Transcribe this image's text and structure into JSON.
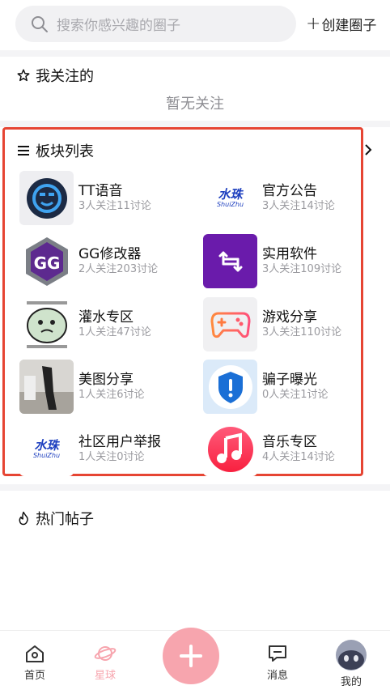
{
  "search": {
    "placeholder": "搜索你感兴趣的圈子"
  },
  "create_label": "创建圈子",
  "following": {
    "title": "我关注的",
    "empty_text": "暂无关注"
  },
  "boards_section": {
    "title": "板块列表"
  },
  "boards": [
    {
      "name": "TT语音",
      "meta": "3人关注11讨论",
      "icon": "tt-voice-icon"
    },
    {
      "name": "官方公告",
      "meta": "3人关注14讨论",
      "icon": "shuizhu-logo",
      "logo_text": "水珠",
      "logo_sub": "ShuiZhu"
    },
    {
      "name": "GG修改器",
      "meta": "2人关注203讨论",
      "icon": "gg-modifier-icon"
    },
    {
      "name": "实用软件",
      "meta": "3人关注109讨论",
      "icon": "swap-arrows-icon"
    },
    {
      "name": "灌水专区",
      "meta": "1人关注47讨论",
      "icon": "meme-image"
    },
    {
      "name": "游戏分享",
      "meta": "3人关注110讨论",
      "icon": "gamepad-icon"
    },
    {
      "name": "美图分享",
      "meta": "1人关注6讨论",
      "icon": "photo-thumbnail"
    },
    {
      "name": "骗子曝光",
      "meta": "0人关注1讨论",
      "icon": "shield-alert-icon"
    },
    {
      "name": "社区用户举报",
      "meta": "1人关注0讨论",
      "icon": "shuizhu-logo",
      "logo_text": "水珠",
      "logo_sub": "ShuiZhu"
    },
    {
      "name": "音乐专区",
      "meta": "4人关注14讨论",
      "icon": "music-note-icon"
    }
  ],
  "hot_posts": {
    "title": "热门帖子"
  },
  "nav": {
    "home": "首页",
    "planet": "星球",
    "messages": "消息",
    "me": "我的"
  },
  "colors": {
    "accent": "#f7a5ae",
    "highlight_frame": "#e64533",
    "planet_active": "#f7a5ae"
  }
}
